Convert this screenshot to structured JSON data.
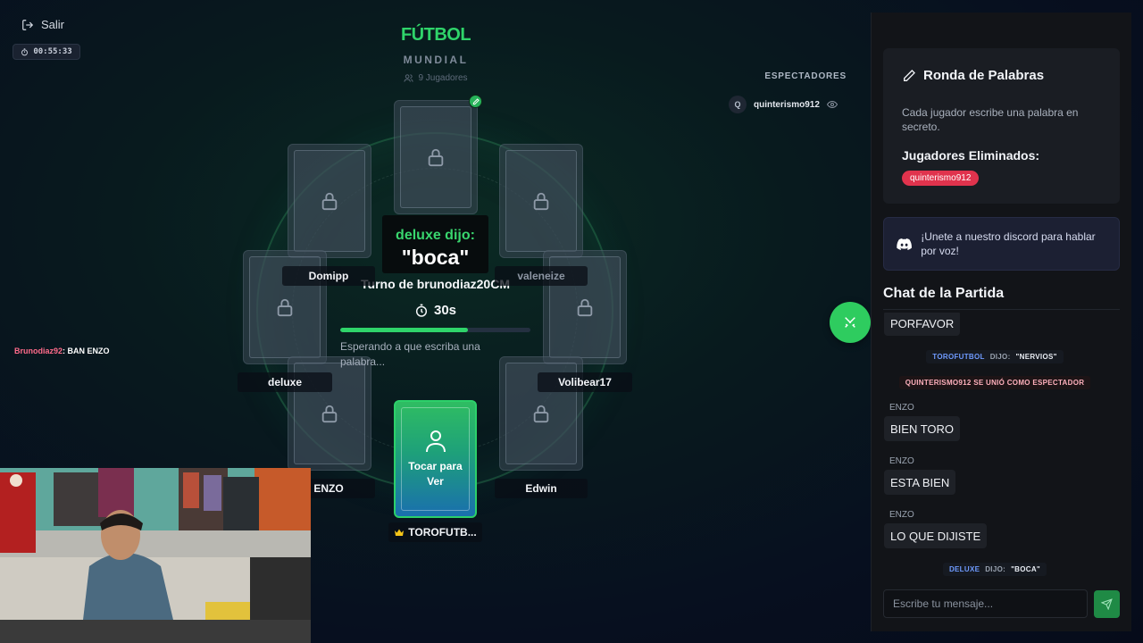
{
  "top_left": {
    "exit_label": "Salir",
    "elapsed": "00:55:33"
  },
  "header": {
    "title": "FÚTBOL",
    "subtitle": "MUNDIAL",
    "players": "9 Jugadores"
  },
  "spectators": {
    "title": "ESPECTADORES",
    "list": [
      {
        "initial": "Q",
        "name": "quinterismo912"
      }
    ]
  },
  "seats": [
    {
      "name": "Domipp"
    },
    {
      "name": "valeneize"
    },
    {
      "name": "deluxe"
    },
    {
      "name": "Volibear17"
    },
    {
      "name": "ENZO"
    },
    {
      "name": "Edwin"
    },
    {
      "name": "TOROFUTB..."
    }
  ],
  "my_card": {
    "label": "Tocar para Ver"
  },
  "turn": {
    "title": "Turno de brunodiaz20CM",
    "timer": "30s",
    "progress": 0.67,
    "waiting": "Esperando a que escriba una palabra..."
  },
  "speech": {
    "who": "deluxe dijo:",
    "word": "\"boca\""
  },
  "overlay_chat": {
    "user": "Brunodiaz92",
    "message": ": BAN ENZO"
  },
  "panel": {
    "rules_title": "Ronda de Palabras",
    "rules_desc": "Cada jugador escribe una palabra en secreto.",
    "eliminated_title": "Jugadores Eliminados:",
    "eliminated": [
      "quinterismo912"
    ],
    "discord_text": "¡Unete a nuestro discord para hablar por voz!",
    "chat_title": "Chat de la Partida",
    "chat": {
      "m0": {
        "text": "PORFAVOR"
      },
      "s1": {
        "name": "TOROFUTBOL",
        "verb": "DIJO:",
        "word": "\"NERVIOS\""
      },
      "s2": {
        "text": "QUINTERISMO912 SE UNIÓ COMO ESPECTADOR"
      },
      "m3": {
        "sender": "ENZO",
        "text": "BIEN TORO"
      },
      "m4": {
        "sender": "ENZO",
        "text": "ESTA BIEN"
      },
      "m5": {
        "sender": "ENZO",
        "text": "LO QUE DIJISTE"
      },
      "s6": {
        "name": "DELUXE",
        "verb": "DIJO:",
        "word": "\"BOCA\""
      }
    },
    "input_placeholder": "Escribe tu mensaje..."
  },
  "colors": {
    "accent_green": "#2fd46a",
    "eliminated_red": "#e0334d",
    "host_crown": "#f5c518"
  }
}
